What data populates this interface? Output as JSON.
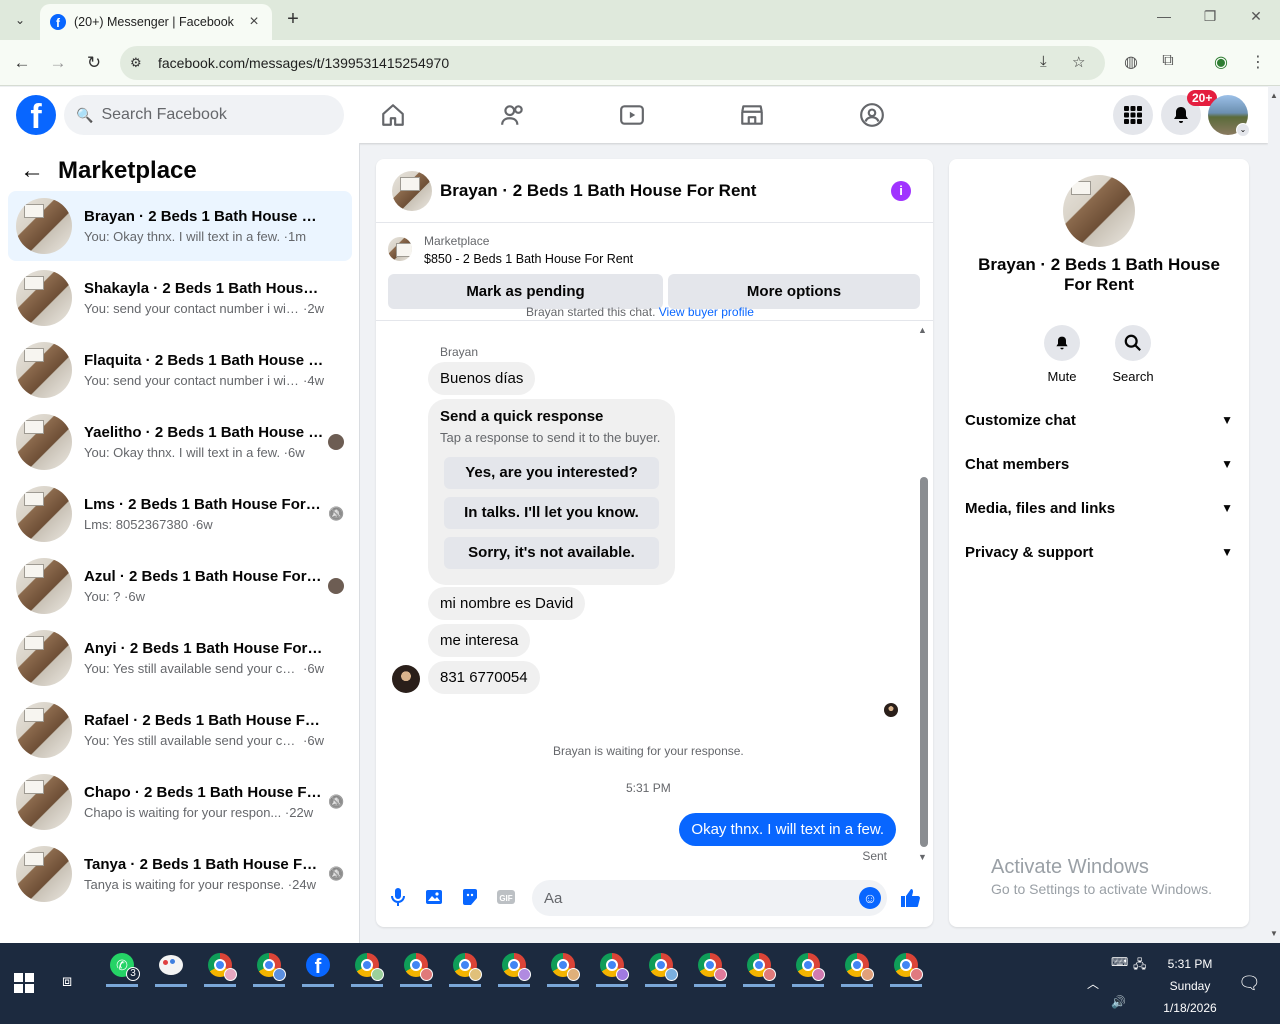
{
  "browser": {
    "tab_title": "(20+) Messenger | Facebook",
    "url": "facebook.com/messages/t/1399531415254970"
  },
  "fb": {
    "search_placeholder": "Search Facebook",
    "notif_badge": "20+",
    "brand_color": "#0866ff"
  },
  "sidebar": {
    "title": "Marketplace",
    "conversations": [
      {
        "name": "Brayan · 2 Beds 1 Bath House For R...",
        "msg": "You: Okay thnx. I will text in a few.",
        "time": "1m",
        "active": true
      },
      {
        "name": "Shakayla · 2 Beds 1 Bath House For...",
        "msg": "You: send your contact number i will ...",
        "time": "2w"
      },
      {
        "name": "Flaquita · 2 Beds 1 Bath House For ...",
        "msg": "You: send your contact number i will ...",
        "time": "4w"
      },
      {
        "name": "Yaelitho · 2 Beds 1 Bath House F...",
        "msg": "You: Okay thnx. I will text in a few.",
        "time": "6w",
        "side": "avatar"
      },
      {
        "name": "Lms · 2 Beds 1 Bath House For R...",
        "msg": "Lms: 8052367380",
        "time": "6w",
        "side": "muted-icon"
      },
      {
        "name": "Azul · 2 Beds 1 Bath House For R...",
        "msg": "You: ?",
        "time": "6w",
        "side": "avatar"
      },
      {
        "name": "Anyi · 2 Beds 1 Bath House For Rent",
        "msg": "You: Yes still available send your cont...",
        "time": "6w"
      },
      {
        "name": "Rafael · 2 Beds 1 Bath House For R...",
        "msg": "You: Yes still available send your cont...",
        "time": "6w"
      },
      {
        "name": "Chapo · 2 Beds 1 Bath House For...",
        "msg": "Chapo is waiting for your respon...",
        "time": "22w",
        "side": "muted-icon"
      },
      {
        "name": "Tanya · 2 Beds 1 Bath House For ...",
        "msg": "Tanya is waiting for your response.",
        "time": "24w",
        "side": "muted-icon"
      }
    ]
  },
  "chat": {
    "header_title": "Brayan · 2 Beds 1 Bath House For Rent",
    "listing_label": "Marketplace",
    "listing_price": "$850 - 2 Beds 1 Bath House For Rent",
    "btn_pending": "Mark as pending",
    "btn_more": "More options",
    "started_text": "Brayan started this chat.",
    "started_link": "View buyer profile",
    "sender_name": "Brayan",
    "msg_1": "Buenos días",
    "quick_title": "Send a quick response",
    "quick_sub": "Tap a response to send it to the buyer.",
    "quick_options": [
      "Yes, are you interested?",
      "In talks. I'll let you know.",
      "Sorry, it's not available."
    ],
    "msg_2": "mi nombre es David",
    "msg_3": "me interesa",
    "msg_4": "831 6770054",
    "waiting": "Brayan is waiting for your response.",
    "time": "5:31 PM",
    "my_msg": "Okay thnx. I will text in a few.",
    "sent": "Sent",
    "composer_placeholder": "Aa"
  },
  "rpanel": {
    "title": "Brayan · 2 Beds 1 Bath House For Rent",
    "mute": "Mute",
    "search": "Search",
    "sections": [
      "Customize chat",
      "Chat members",
      "Media, files and links",
      "Privacy & support"
    ]
  },
  "watermark": {
    "line1": "Activate Windows",
    "line2": "Go to Settings to activate Windows."
  },
  "taskbar": {
    "whatsapp_count": "3",
    "time": "5:31 PM",
    "day": "Sunday",
    "date": "1/18/2026"
  }
}
